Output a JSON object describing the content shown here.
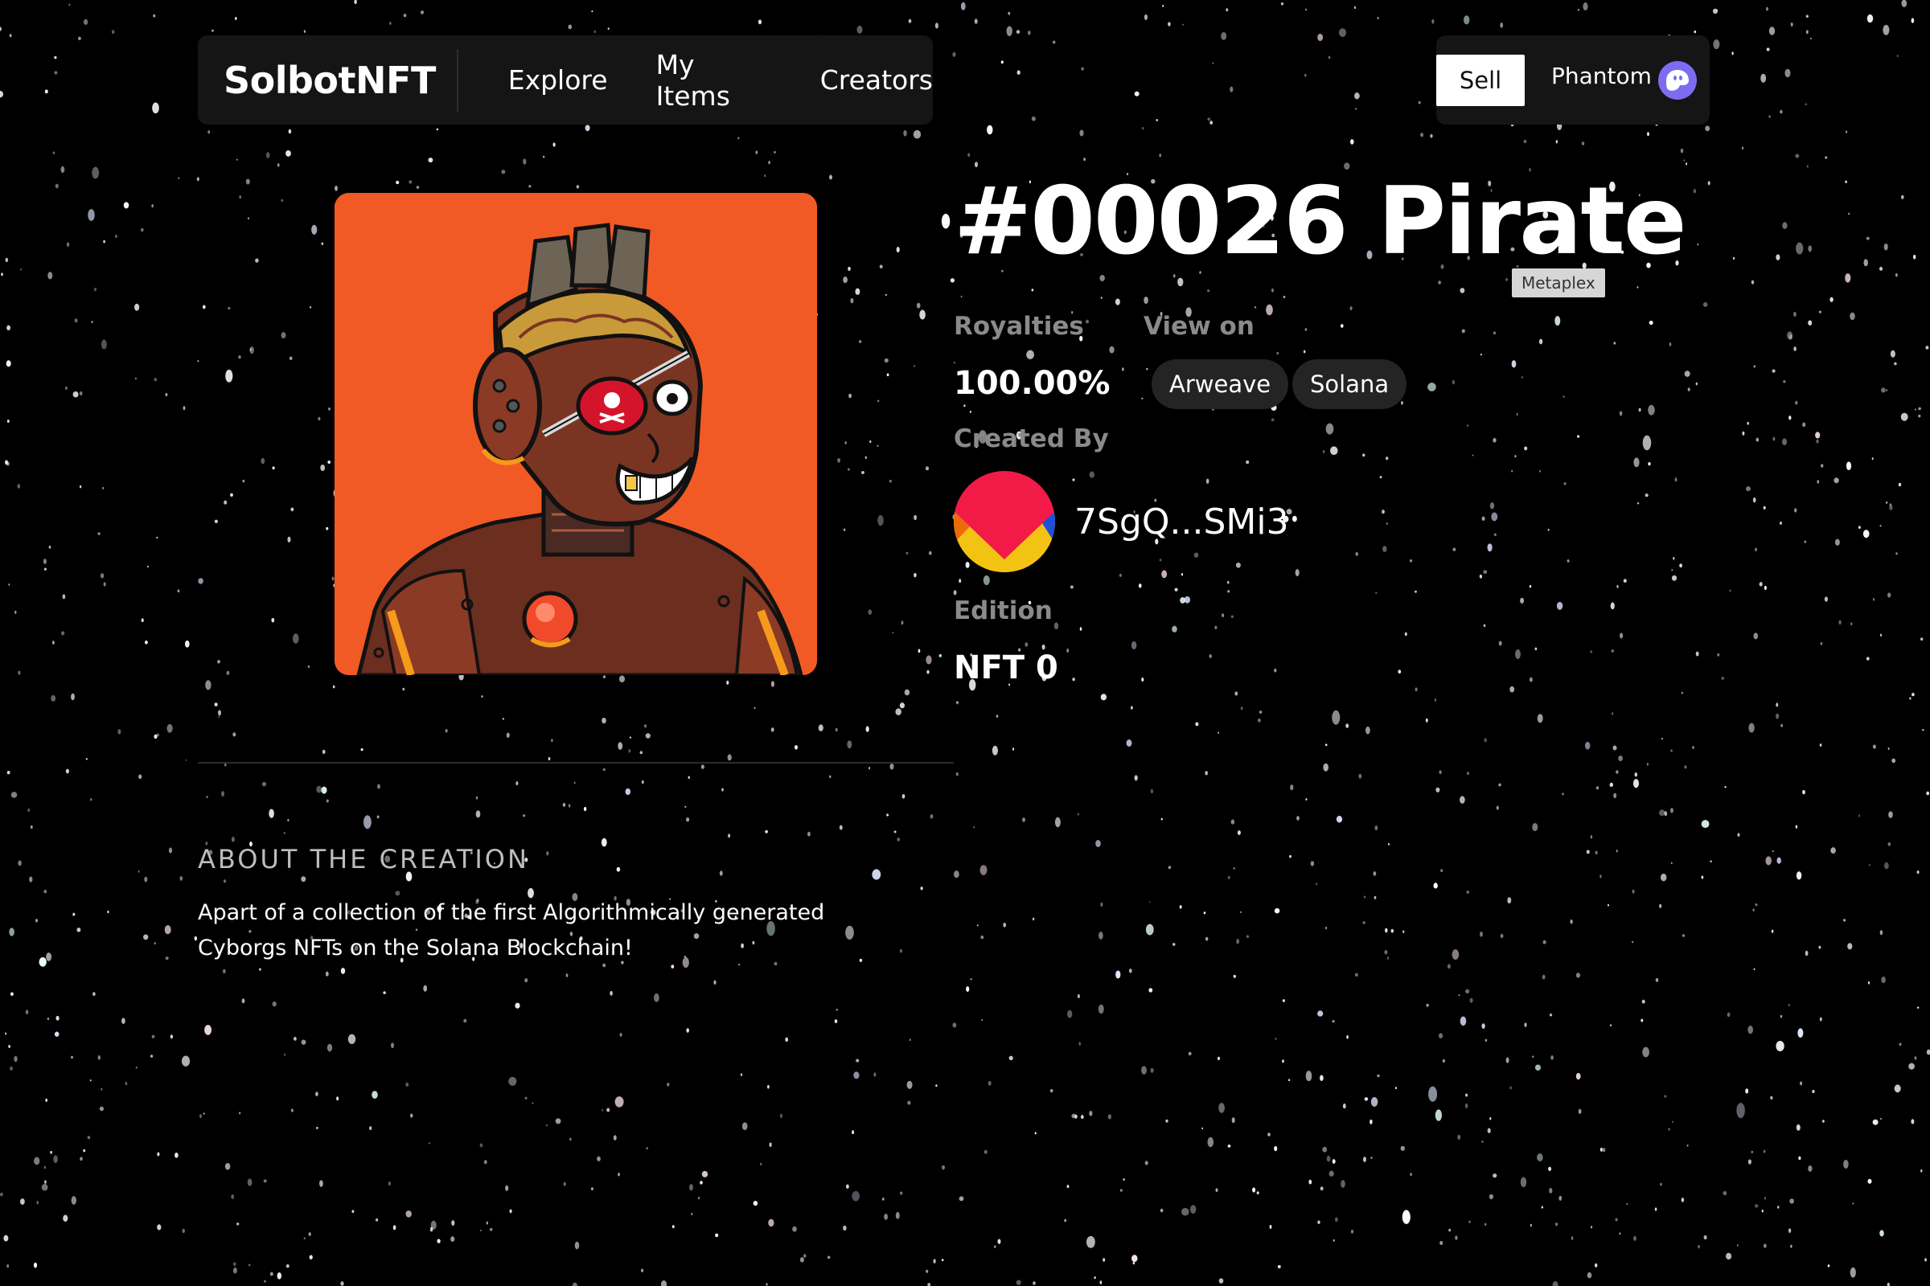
{
  "nav": {
    "brand": "SolbotNFT",
    "links": [
      "Explore",
      "My Items",
      "Creators"
    ],
    "sell_label": "Sell",
    "wallet_label": "Phantom"
  },
  "item": {
    "title": "#00026 Pirate",
    "tooltip": "Metaplex",
    "royalties_label": "Royalties",
    "royalties_value": "100.00%",
    "view_on_label": "View on",
    "view_on_links": [
      "Arweave",
      "Solana"
    ],
    "created_by_label": "Created By",
    "creator_address": "7SgQ...SMi3",
    "edition_label": "Edition",
    "edition_value": "NFT 0"
  },
  "about": {
    "title": "ABOUT THE CREATION",
    "text": "Apart of a collection of the first Algorithmically generated Cyborgs NFTs on the Solana Blockchain!"
  },
  "colors": {
    "background": "#000000",
    "panel": "#151515",
    "art_background": "#f15a24",
    "phantom": "#7d6cf0"
  },
  "icons": {
    "wallet": "phantom-ghost-icon",
    "creator": "creator-identicon"
  }
}
